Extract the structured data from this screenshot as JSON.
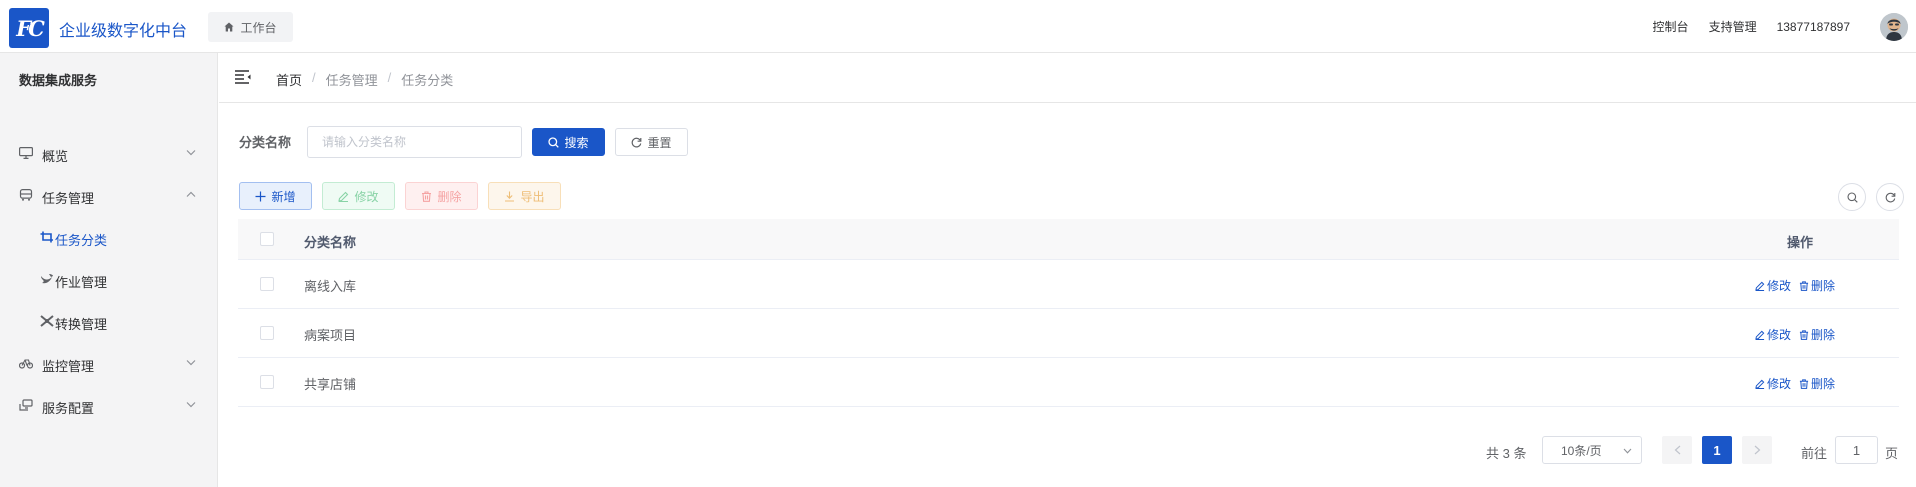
{
  "header": {
    "logo_text": "FC",
    "app_title": "企业级数字化中台",
    "home_tab": "工作台",
    "links": [
      "控制台",
      "支持管理"
    ],
    "phone": "13877187897"
  },
  "sidebar": {
    "title": "数据集成服务",
    "items": [
      {
        "label": "概览"
      },
      {
        "label": "任务管理"
      },
      {
        "label": "任务分类"
      },
      {
        "label": "作业管理"
      },
      {
        "label": "转换管理"
      },
      {
        "label": "监控管理"
      },
      {
        "label": "服务配置"
      }
    ]
  },
  "breadcrumb": [
    "首页",
    "任务管理",
    "任务分类"
  ],
  "search": {
    "label": "分类名称",
    "placeholder": "请输入分类名称",
    "search_button": "搜索",
    "reset_button": "重置"
  },
  "toolbar": {
    "add": "新增",
    "edit": "修改",
    "delete": "删除",
    "export": "导出"
  },
  "table": {
    "columns": [
      "分类名称",
      "操作"
    ],
    "rows": [
      {
        "name": "离线入库",
        "edit": "修改",
        "delete": "删除"
      },
      {
        "name": "病案项目",
        "edit": "修改",
        "delete": "删除"
      },
      {
        "name": "共享店铺",
        "edit": "修改",
        "delete": "删除"
      }
    ]
  },
  "pagination": {
    "total": "共 3 条",
    "page_size": "10条/页",
    "current_page": "1",
    "goto_label": "前往",
    "goto_value": "1",
    "page_label": "页"
  },
  "colors": {
    "primary": "#1a56c8",
    "sidebar_bg": "#f4f4f5",
    "success_light": "#88d3a6",
    "danger_light": "#f5a3a3",
    "warning_light": "#eebe77"
  }
}
